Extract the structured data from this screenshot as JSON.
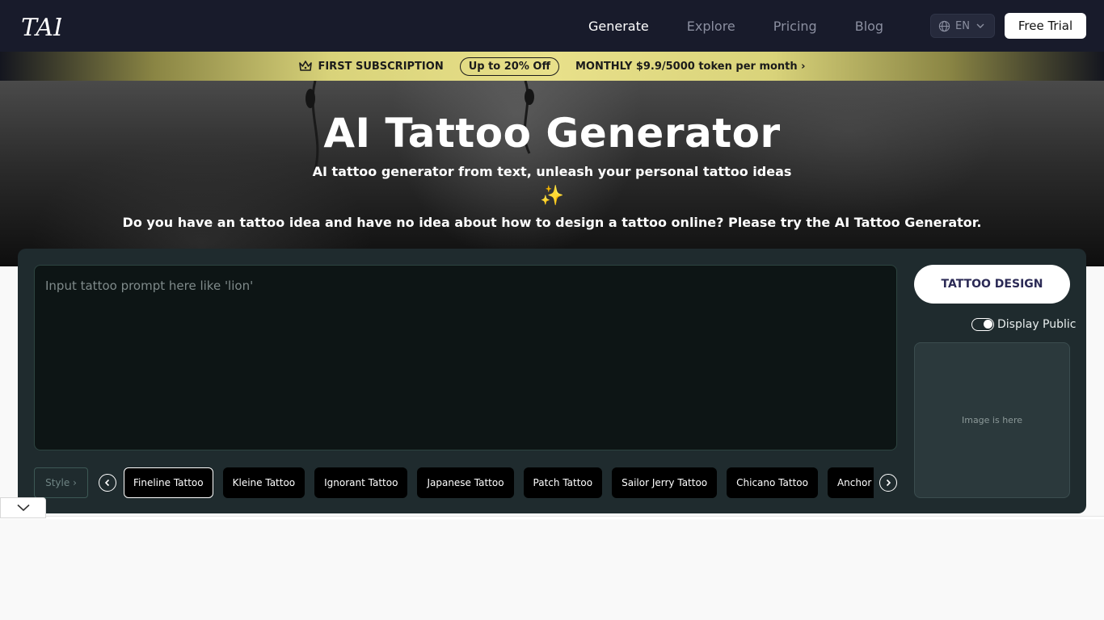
{
  "nav": {
    "logo_text": "TAI",
    "links": [
      {
        "label": "Generate",
        "active": true
      },
      {
        "label": "Explore",
        "active": false
      },
      {
        "label": "Pricing",
        "active": false
      },
      {
        "label": "Blog",
        "active": false
      }
    ],
    "language": "EN",
    "cta": "Free Trial"
  },
  "promo": {
    "label": "FIRST SUBSCRIPTION",
    "badge": "Up to 20% Off",
    "link": "MONTHLY $9.9/5000 token per month ›"
  },
  "hero": {
    "title": "AI Tattoo Generator",
    "subtitle": "AI tattoo generator from text, unleash your personal tattoo ideas",
    "sparkle": "✨",
    "description": "Do you have an tattoo idea and have no idea about how to design a tattoo online? Please try the AI Tattoo Generator."
  },
  "generator": {
    "prompt_placeholder": "Input tattoo prompt here like 'lion'",
    "style_label": "Style ›",
    "styles": [
      "Fineline Tattoo",
      "Kleine Tattoo",
      "Ignorant Tattoo",
      "Japanese Tattoo",
      "Patch Tattoo",
      "Sailor Jerry Tattoo",
      "Chicano Tattoo",
      "Anchor Tattoo"
    ],
    "selected_style_index": 0,
    "design_button": "TATTOO DESIGN",
    "display_public_label": "Display Public",
    "display_public_on": true,
    "image_placeholder": "Image is here"
  },
  "colors": {
    "nav_bg": "#181b2b",
    "panel_bg": "#1f2b2e",
    "promo_gold": "#e8e08a",
    "accent_text": "#2b2a55"
  }
}
